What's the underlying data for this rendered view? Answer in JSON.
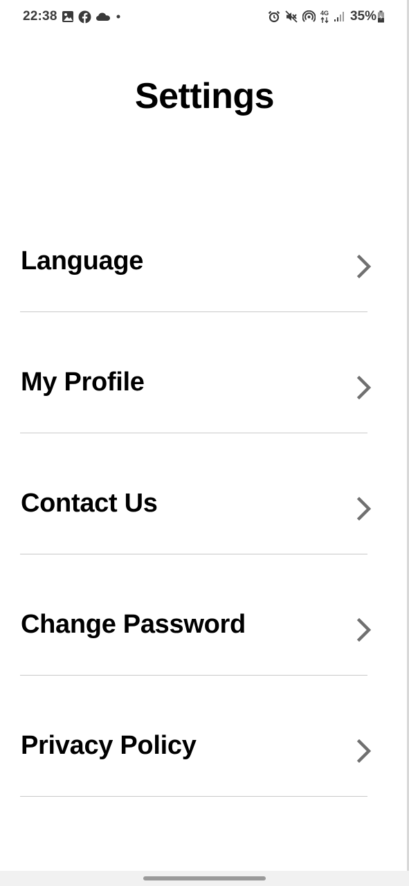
{
  "status_bar": {
    "time": "22:38",
    "left_icons": [
      "gallery-icon",
      "facebook-icon",
      "cloud-icon",
      "dot-icon"
    ],
    "right_icons": [
      "alarm-icon",
      "mute-icon",
      "hotspot-icon",
      "network-4g-icon",
      "signal-icon"
    ],
    "network_label": "4G",
    "battery": "35%"
  },
  "page": {
    "title": "Settings"
  },
  "settings": {
    "items": [
      {
        "label": "Language"
      },
      {
        "label": "My Profile"
      },
      {
        "label": "Contact Us"
      },
      {
        "label": "Change Password"
      },
      {
        "label": "Privacy Policy"
      }
    ]
  },
  "colors": {
    "background": "#ffffff",
    "text": "#000000",
    "chevron": "#707070",
    "divider": "#c8c8c8",
    "status_text": "#3a3a3a"
  }
}
